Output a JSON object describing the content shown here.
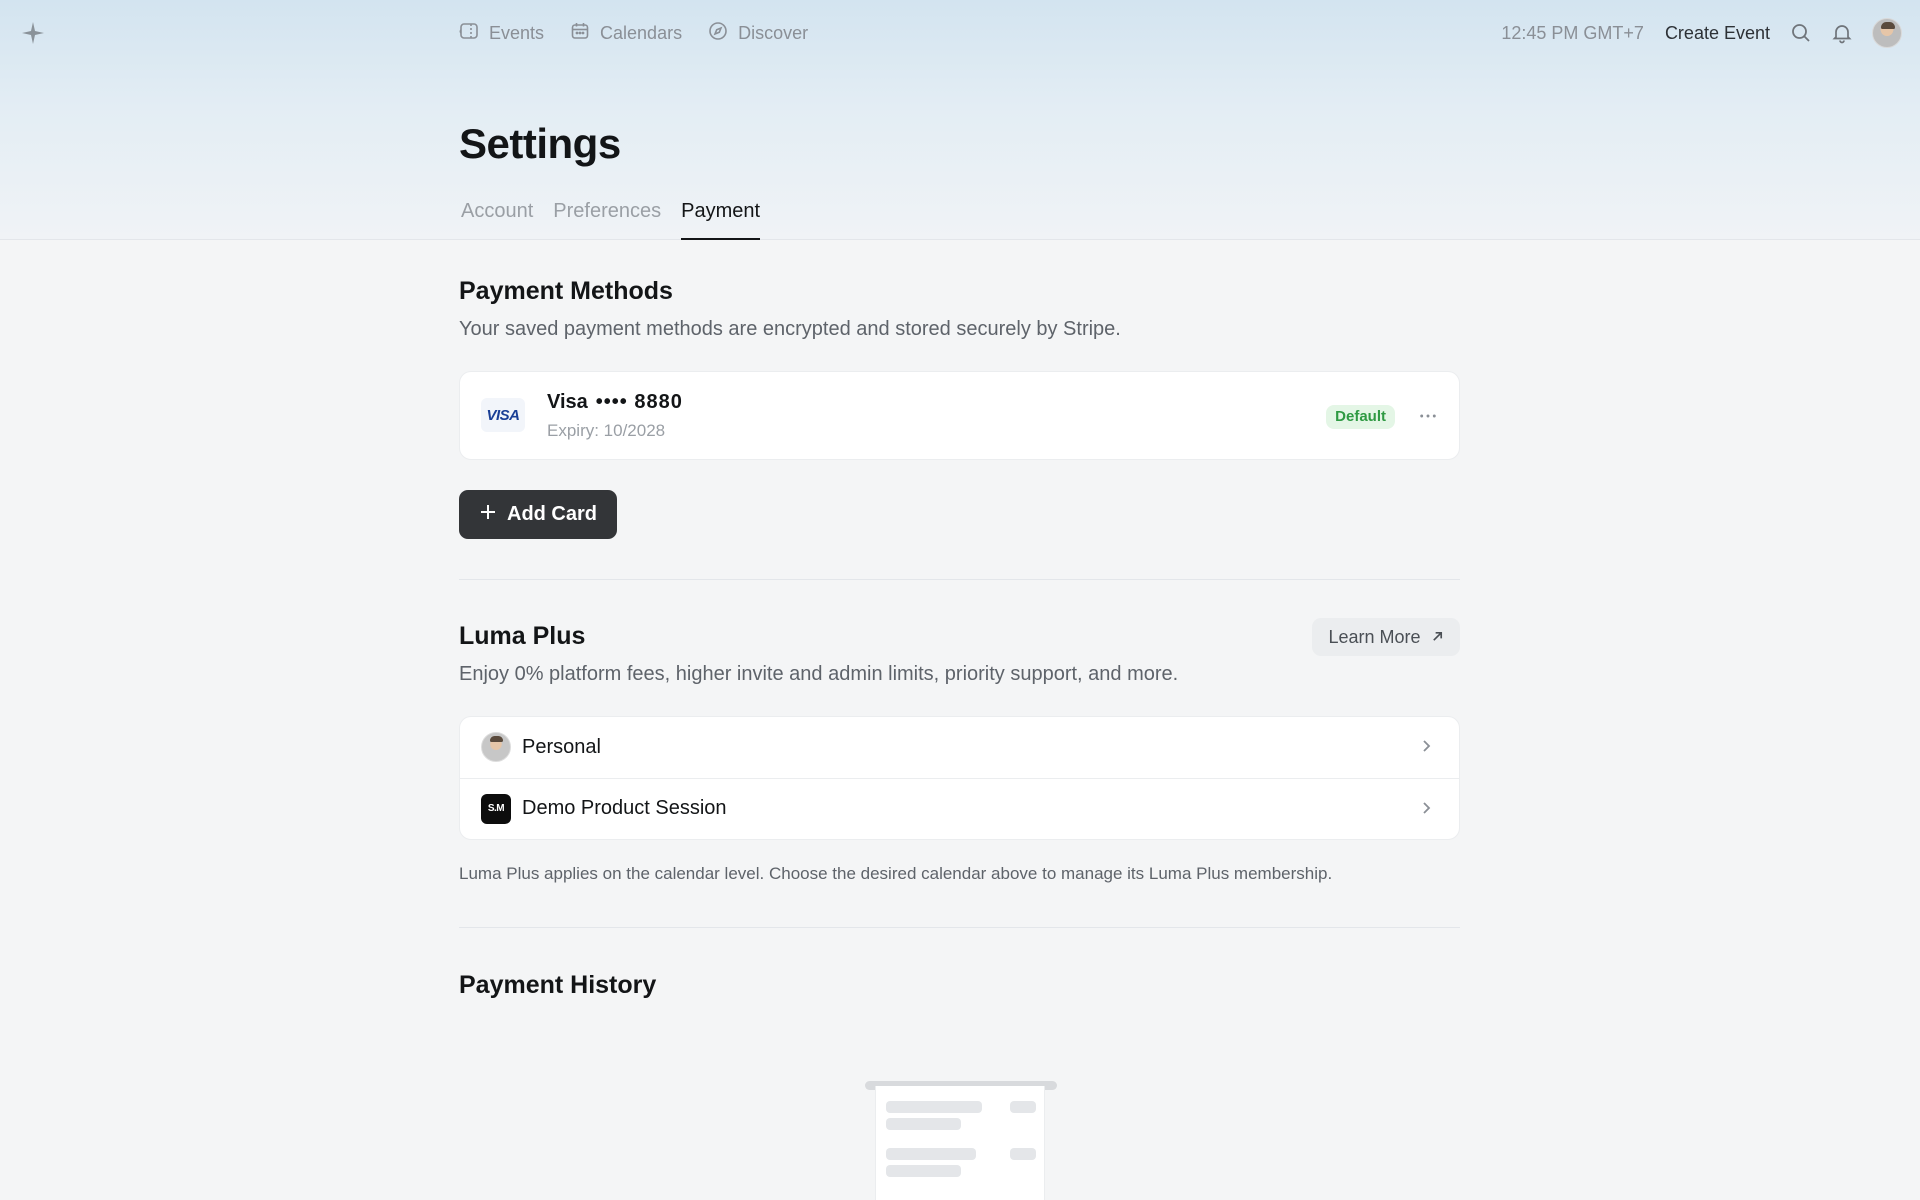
{
  "header": {
    "nav": [
      {
        "label": "Events",
        "icon": "ticket-icon"
      },
      {
        "label": "Calendars",
        "icon": "calendar-icon"
      },
      {
        "label": "Discover",
        "icon": "compass-icon"
      }
    ],
    "time": "12:45 PM GMT+7",
    "create_event": "Create Event"
  },
  "page": {
    "title": "Settings",
    "tabs": [
      {
        "label": "Account",
        "active": false
      },
      {
        "label": "Preferences",
        "active": false
      },
      {
        "label": "Payment",
        "active": true
      }
    ]
  },
  "payment_methods": {
    "title": "Payment Methods",
    "description": "Your saved payment methods are encrypted and stored securely by Stripe.",
    "cards": [
      {
        "brand": "Visa",
        "brand_logo": "VISA",
        "masked": "•••• 8880",
        "expiry": "Expiry: 10/2028",
        "badge": "Default"
      }
    ],
    "add_card_label": "Add Card"
  },
  "luma_plus": {
    "title": "Luma Plus",
    "learn_more": "Learn More",
    "description": "Enjoy 0% platform fees, higher invite and admin limits, priority support, and more.",
    "calendars": [
      {
        "label": "Personal"
      },
      {
        "label": "Demo Product Session",
        "logo_text": "S.M"
      }
    ],
    "note": "Luma Plus applies on the calendar level. Choose the desired calendar above to manage its Luma Plus membership."
  },
  "payment_history": {
    "title": "Payment History"
  },
  "colors": {
    "accent_dark": "#333538",
    "default_badge_bg": "#e4f6e6",
    "default_badge_text": "#2f9a43"
  }
}
